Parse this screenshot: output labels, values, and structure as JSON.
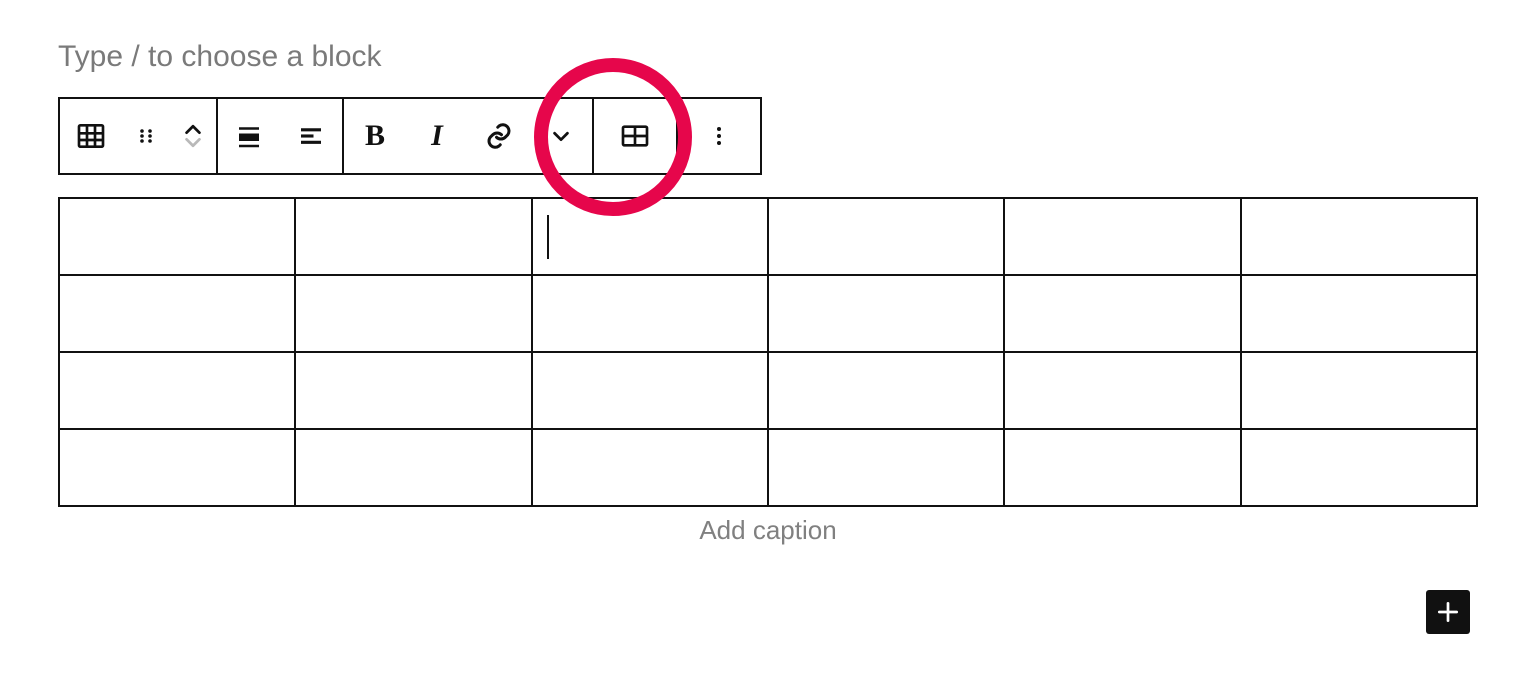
{
  "prompt": {
    "placeholder": "Type / to choose a block"
  },
  "toolbar": {
    "block_type": "table",
    "bold_label": "B",
    "italic_label": "I"
  },
  "table": {
    "columns": 6,
    "rows": 4,
    "caption_placeholder": "Add caption",
    "active_cell": {
      "row": 0,
      "col": 2
    },
    "cells": [
      [
        "",
        "",
        "",
        "",
        "",
        ""
      ],
      [
        "",
        "",
        "",
        "",
        "",
        ""
      ],
      [
        "",
        "",
        "",
        "",
        "",
        ""
      ],
      [
        "",
        "",
        "",
        "",
        "",
        ""
      ]
    ]
  },
  "annotation": {
    "highlight_target": "link-and-more-formatting-buttons"
  }
}
